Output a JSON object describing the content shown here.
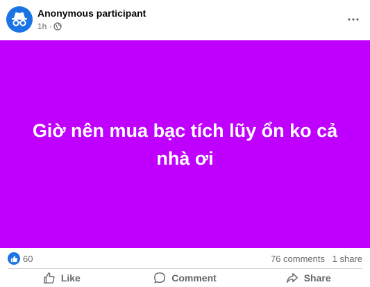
{
  "post": {
    "author": "Anonymous participant",
    "time": "1h",
    "separator": "·",
    "text": "Giờ nên mua bạc tích lũy ổn ko cả nhà ơi",
    "background_color": "#c000ff"
  },
  "stats": {
    "likes": "60",
    "comments": "76 comments",
    "shares": "1 share"
  },
  "actions": {
    "like_label": "Like",
    "comment_label": "Comment",
    "share_label": "Share"
  },
  "icons": {
    "avatar": "anonymous-incognito-icon",
    "audience": "globe-icon",
    "more": "more-horizontal-icon",
    "reaction": "thumbs-up-icon",
    "like": "thumbs-up-outline-icon",
    "comment": "speech-bubble-icon",
    "share": "share-arrow-icon"
  },
  "colors": {
    "accent": "#1b74e4",
    "secondary_text": "#65676b"
  }
}
